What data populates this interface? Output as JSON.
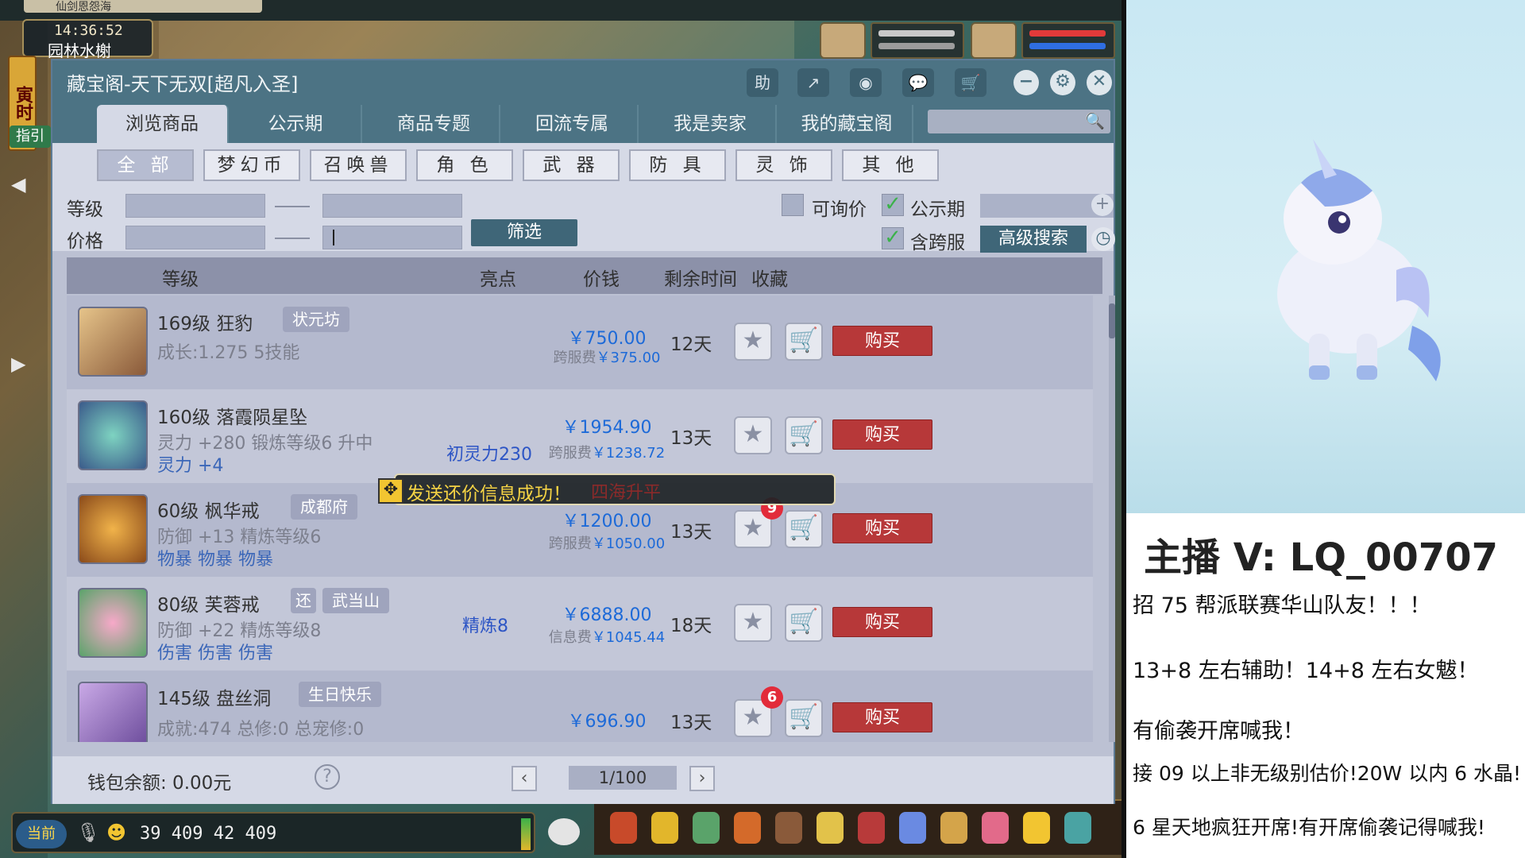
{
  "game": {
    "window_tab": "仙剑恩怨海",
    "time": "14:36:52",
    "location": "园林水榭",
    "side_label": "寅时",
    "guide_label": "指引",
    "current_channel": "当前",
    "coordinates": "39 409  42 409"
  },
  "window": {
    "title": "藏宝阁-天下无双[超凡入圣]",
    "icons": {
      "help": "助",
      "share": "share-icon",
      "record": "record-icon",
      "chat": "chat-icon",
      "cart": "cart-icon",
      "minimize": "−",
      "settings": "⚙",
      "close": "✕"
    }
  },
  "main_tabs": [
    "浏览商品",
    "公示期",
    "商品专题",
    "回流专属",
    "我是卖家",
    "我的藏宝阁"
  ],
  "categories": [
    "全 部",
    "梦幻币",
    "召唤兽",
    "角 色",
    "武 器",
    "防 具",
    "灵 饰",
    "其 他"
  ],
  "filters": {
    "level_label": "等级",
    "price_label": "价格",
    "filter_button": "筛选",
    "negotiable_label": "可询价",
    "public_label": "公示期",
    "cross_server_label": "含跨服",
    "advanced_search": "高级搜索"
  },
  "table": {
    "headers": {
      "level": "等级",
      "highlight": "亮点",
      "price": "价钱",
      "remaining": "剩余时间",
      "favorite": "收藏"
    },
    "rows": [
      {
        "title": "169级 狂豹",
        "tags": [
          "状元坊"
        ],
        "sub1": "成长:1.275 5技能",
        "sub2": "",
        "highlight": "",
        "price": "￥750.00",
        "fee_label": "跨服费",
        "fee": "￥375.00",
        "remaining": "12天",
        "fav_count": "",
        "buy": "购买"
      },
      {
        "title": "160级 落霞陨星坠",
        "tags": [],
        "sub1": "灵力 +280 锻炼等级6 升中",
        "sub2": "灵力 +4",
        "highlight": "初灵力230",
        "price": "￥1954.90",
        "fee_label": "跨服费",
        "fee": "￥1238.72",
        "remaining": "13天",
        "fav_count": "",
        "buy": "购买"
      },
      {
        "title": "60级 枫华戒",
        "tags": [
          "成都府"
        ],
        "sub1": "防御 +13 精炼等级6",
        "sub2": "物暴 物暴 物暴",
        "highlight": "",
        "price": "￥1200.00",
        "fee_label": "跨服费",
        "fee": "￥1050.00",
        "remaining": "13天",
        "fav_count": "9",
        "buy": "购买"
      },
      {
        "title": "80级 芙蓉戒",
        "tags": [
          "还",
          "武当山"
        ],
        "sub1": "防御 +22 精炼等级8",
        "sub2": "伤害 伤害 伤害",
        "highlight": "精炼8",
        "price": "￥6888.00",
        "fee_label": "信息费",
        "fee": "￥1045.44",
        "remaining": "18天",
        "fav_count": "",
        "buy": "购买"
      },
      {
        "title": "145级 盘丝洞",
        "tags": [
          "生日快乐"
        ],
        "sub1": "成就:474 总修:0 总宠修:0",
        "sub2": "",
        "highlight": "",
        "price": "￥696.90",
        "fee_label": "",
        "fee": "",
        "remaining": "13天",
        "fav_count": "6",
        "buy": "购买"
      }
    ]
  },
  "toast": {
    "text": "发送还价信息成功！",
    "behind_server": "四海升平"
  },
  "footer": {
    "wallet": "钱包余额: 0.00元",
    "page": "1/100",
    "help": "?"
  },
  "streamer": {
    "host": "主播 V: LQ_00707",
    "lines": [
      "招 75 帮派联赛华山队友！！！",
      "13+8 左右辅助！14+8 左右女魃！",
      "有偷袭开席喊我！",
      "接 09 以上非无级别估价!20W 以内 6 水晶!",
      "6 星天地疯狂开席!有开席偷袭记得喊我!"
    ]
  },
  "colors": {
    "accent": "#4c7384",
    "buy": "#b73839",
    "price": "#1d6ad8",
    "check": "#3bb24a"
  }
}
